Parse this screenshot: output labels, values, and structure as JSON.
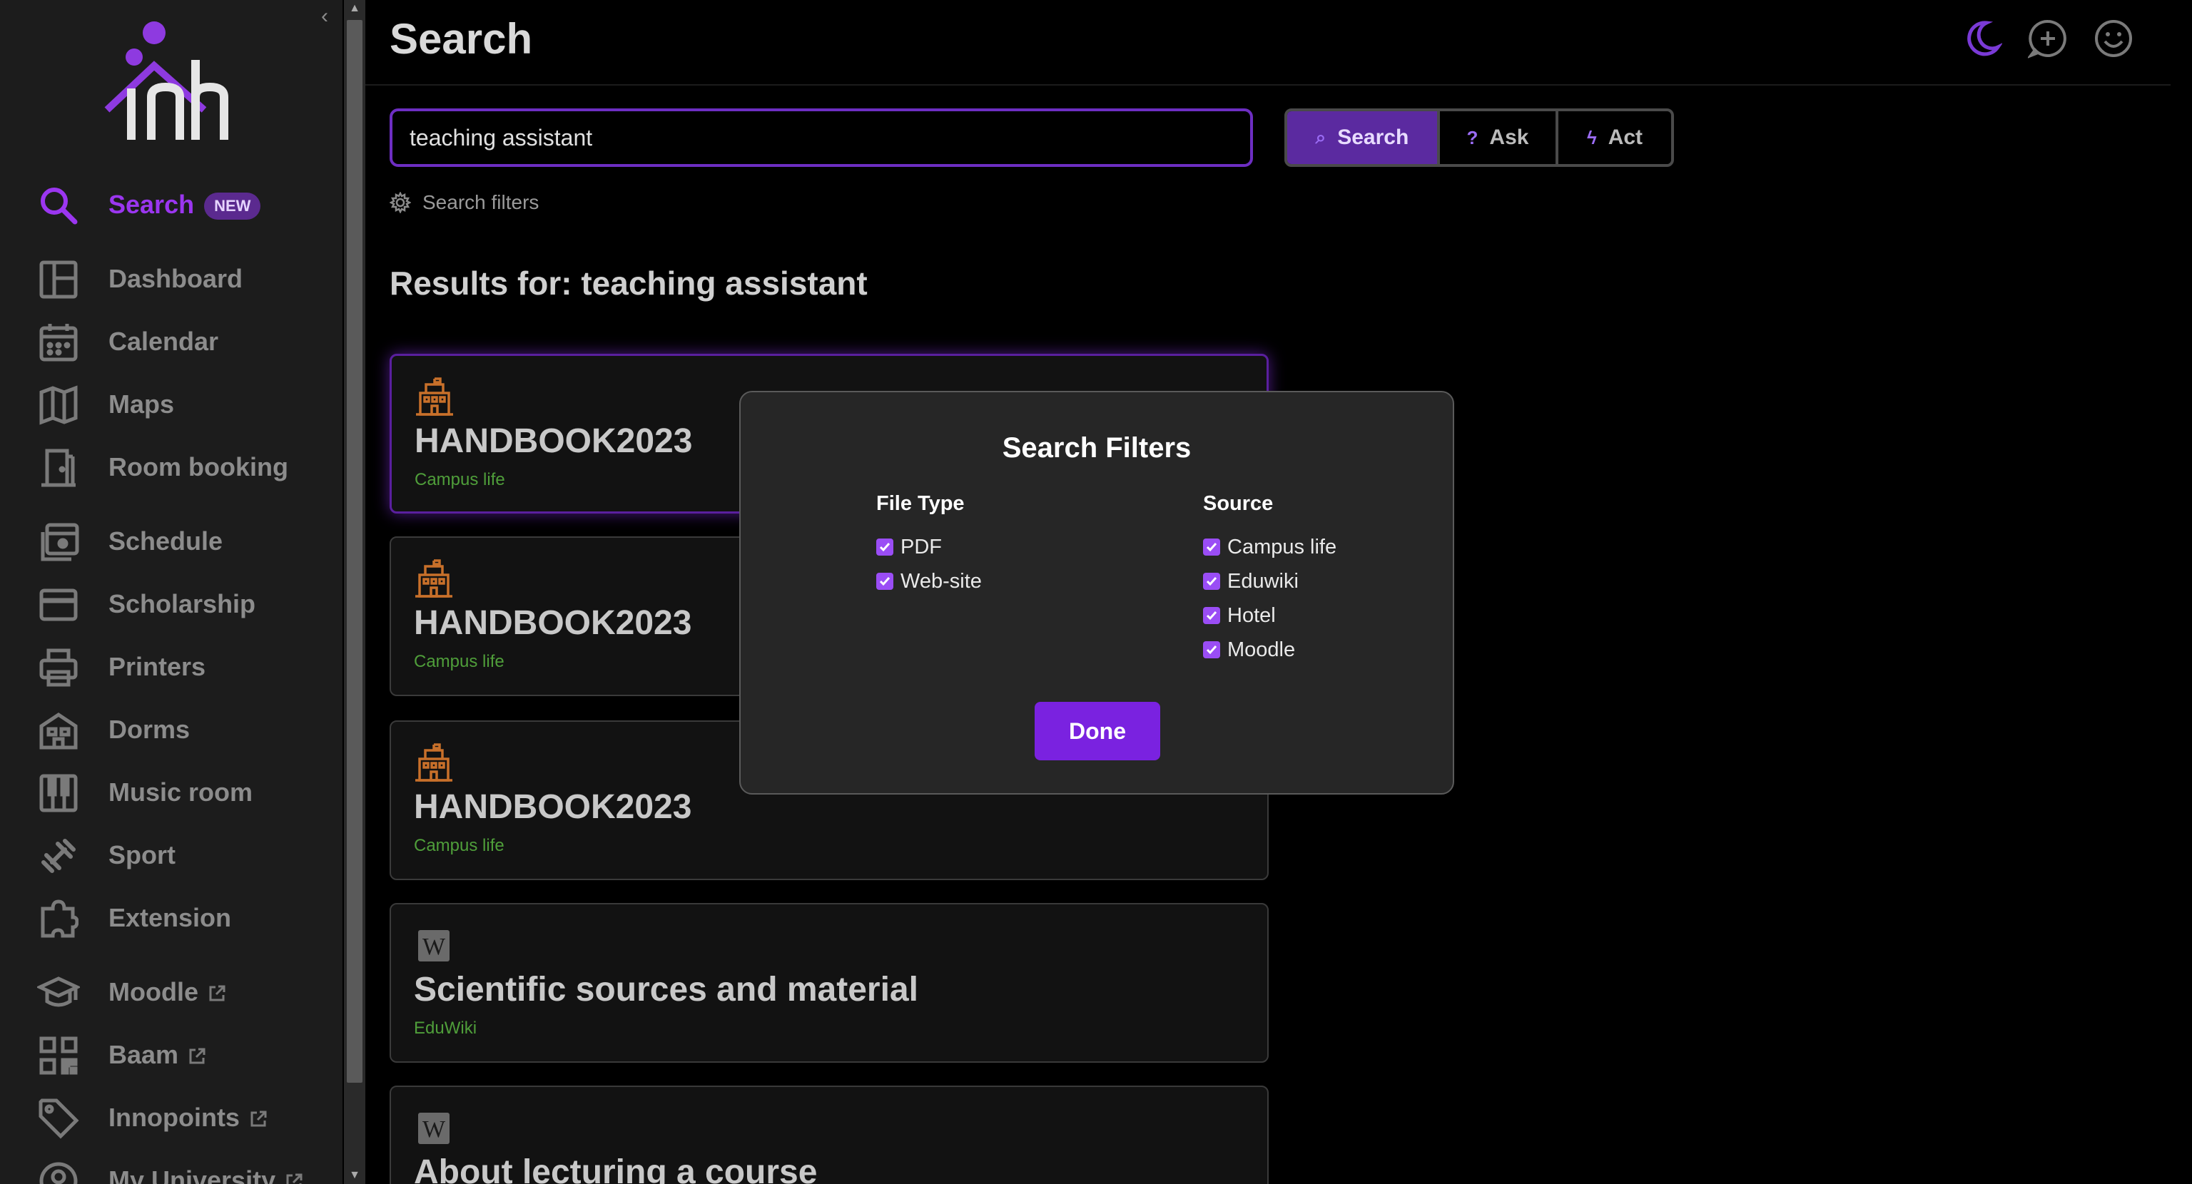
{
  "sidebar": {
    "collapse_icon": "chevron-left-icon",
    "logo_text": "inh",
    "badge_new": "NEW",
    "items": [
      {
        "label": "Search",
        "icon": "search-icon",
        "active": true
      },
      {
        "label": "Dashboard",
        "icon": "dashboard-icon"
      },
      {
        "label": "Calendar",
        "icon": "calendar-icon"
      },
      {
        "label": "Maps",
        "icon": "map-icon"
      },
      {
        "label": "Room booking",
        "icon": "door-icon"
      },
      {
        "label": "Schedule",
        "icon": "schedule-icon"
      },
      {
        "label": "Scholarship",
        "icon": "card-icon"
      },
      {
        "label": "Printers",
        "icon": "printer-icon"
      },
      {
        "label": "Dorms",
        "icon": "building-icon"
      },
      {
        "label": "Music room",
        "icon": "piano-icon"
      },
      {
        "label": "Sport",
        "icon": "dumbbell-icon"
      },
      {
        "label": "Extension",
        "icon": "puzzle-icon"
      },
      {
        "label": "Moodle",
        "icon": "graduation-cap-icon",
        "external": true
      },
      {
        "label": "Baam",
        "icon": "qr-code-icon",
        "external": true
      },
      {
        "label": "Innopoints",
        "icon": "tag-icon",
        "external": true
      },
      {
        "label": "My University",
        "icon": "user-circle-icon",
        "external": true
      }
    ]
  },
  "header": {
    "title": "Search",
    "icons": [
      "moon-icon",
      "chat-plus-icon",
      "smiley-icon"
    ]
  },
  "search": {
    "value": "teaching assistant",
    "buttons": [
      {
        "label": "Search",
        "icon": "search-icon",
        "active": true
      },
      {
        "label": "Ask",
        "icon": "question-icon"
      },
      {
        "label": "Act",
        "icon": "lightning-icon"
      }
    ],
    "filters_label": "Search filters"
  },
  "results": {
    "title": "Results for: teaching assistant",
    "items": [
      {
        "title": "HANDBOOK2023",
        "source": "Campus life",
        "icon": "building-icon"
      },
      {
        "title": "HANDBOOK2023",
        "source": "Campus life",
        "icon": "building-icon"
      },
      {
        "title": "HANDBOOK2023",
        "source": "Campus life",
        "icon": "building-icon"
      },
      {
        "title": "Scientific sources and material",
        "source": "EduWiki",
        "icon": "wiki-icon"
      },
      {
        "title": "About lecturing a course",
        "source": "",
        "icon": "wiki-icon"
      }
    ]
  },
  "modal": {
    "title": "Search Filters",
    "file_type": {
      "heading": "File Type",
      "options": [
        "PDF",
        "Web-site"
      ]
    },
    "source": {
      "heading": "Source",
      "options": [
        "Campus life",
        "Eduwiki",
        "Hotel",
        "Moodle"
      ]
    },
    "done_label": "Done"
  },
  "colors": {
    "accent": "#9b36f0",
    "active_button": "#5b2aa0",
    "source_text": "#4f9e3a",
    "card_icon": "#c8702a"
  }
}
